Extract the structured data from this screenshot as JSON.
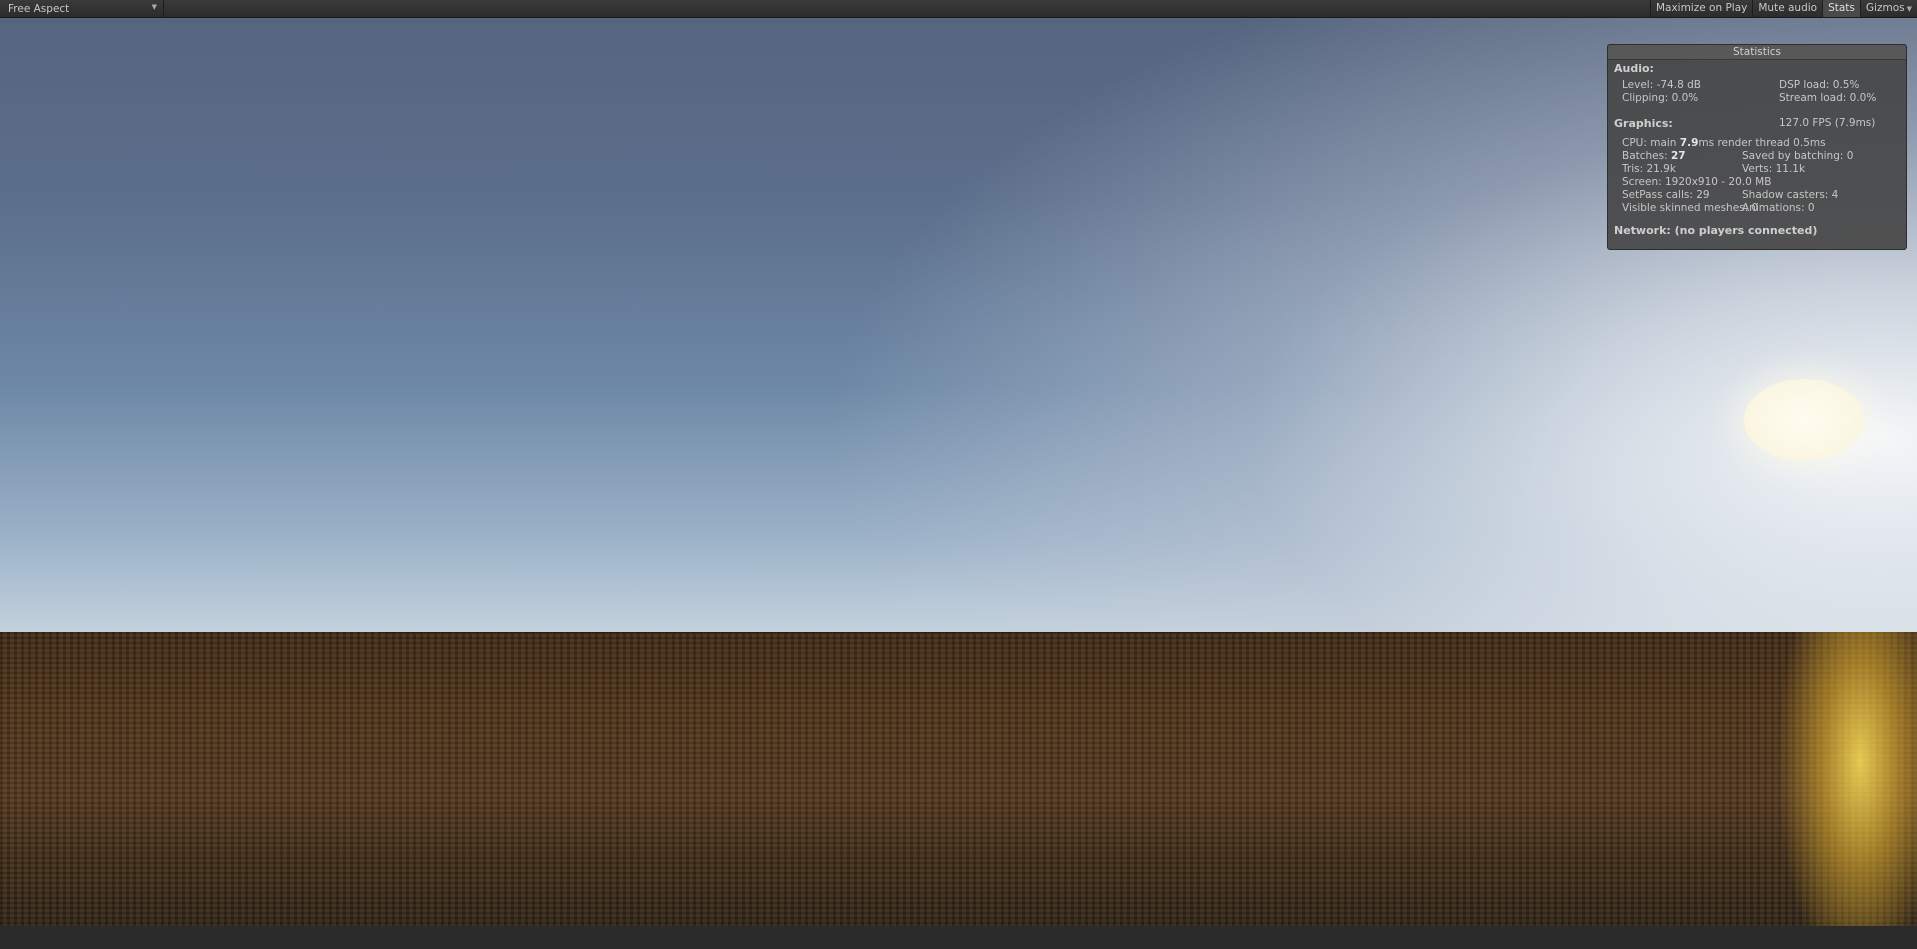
{
  "toolbar": {
    "aspect": "Free Aspect",
    "maximize": "Maximize on Play",
    "mute": "Mute audio",
    "stats": "Stats",
    "gizmos": "Gizmos"
  },
  "stats": {
    "title": "Statistics",
    "audio_header": "Audio:",
    "level": "Level: -74.8 dB",
    "dsp": "DSP load: 0.5%",
    "clipping": "Clipping: 0.0%",
    "stream": "Stream load: 0.0%",
    "graphics_header": "Graphics:",
    "fps": "127.0 FPS (7.9ms)",
    "cpu_prefix": "CPU: main ",
    "cpu_main": "7.9",
    "cpu_suffix": "ms  render thread 0.5ms",
    "batches_prefix": "Batches: ",
    "batches": "27",
    "saved": "Saved by batching: 0",
    "tris": "Tris: 21.9k",
    "verts": "Verts: 11.1k",
    "screen": "Screen: 1920x910 - 20.0 MB",
    "setpass": "SetPass calls: 29",
    "shadow": "Shadow casters: 4",
    "skinned": "Visible skinned meshes: 0",
    "animations": "Animations: 0",
    "network": "Network: (no players connected)"
  }
}
